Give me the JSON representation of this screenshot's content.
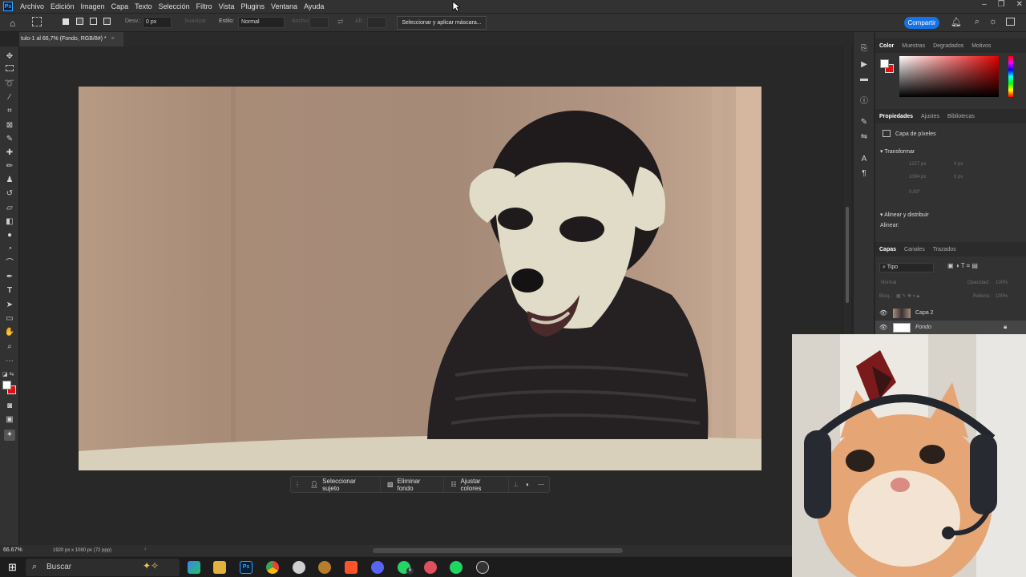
{
  "menu": {
    "logo": "Ps",
    "items": [
      "Archivo",
      "Edición",
      "Imagen",
      "Capa",
      "Texto",
      "Selección",
      "Filtro",
      "Vista",
      "Plugins",
      "Ventana",
      "Ayuda"
    ]
  },
  "options": {
    "feather_label": "Desv.:",
    "feather_value": "0 px",
    "antialias_label": "Suavizar",
    "style_label": "Estilo:",
    "style_value": "Normal",
    "width_label": "Anchu:",
    "height_label": "Alt.:",
    "mask_button": "Seleccionar y aplicar máscara...",
    "share_button": "Compartir"
  },
  "document": {
    "tab_title": "tulo-1 al 66,7% (Fondo, RGB/8#) *",
    "zoom": "66.67%",
    "size_info": "1920 px x 1080 px (72 ppp)"
  },
  "contextual_bar": {
    "select_subject": "Seleccionar sujeto",
    "remove_background": "Eliminar fondo",
    "adjust_colors": "Ajustar colores"
  },
  "color_panel": {
    "tabs": [
      "Color",
      "Muestras",
      "Degradados",
      "Motivos"
    ],
    "foreground": "#ffffff",
    "background": "#e01010"
  },
  "properties_panel": {
    "tabs": [
      "Propiedades",
      "Ajustes",
      "Bibliotecas"
    ],
    "layer_type": "Capa de píxeles",
    "transform_title": "Transformar",
    "fields": [
      "1227 px",
      "0 px",
      "1094 px",
      "0 px",
      "0,00°"
    ],
    "align_title": "Alinear y distribuir",
    "align_label": "Alinear:"
  },
  "layers_panel": {
    "tabs": [
      "Capas",
      "Canales",
      "Trazados"
    ],
    "filter_label": "Tipo",
    "blend_mode": "Normal",
    "opacity_label": "Opacidad:",
    "opacity_value": "100%",
    "lock_label": "Bloq.:",
    "fill_label": "Relleno:",
    "fill_value": "100%",
    "layers": [
      {
        "name": "Capa 2"
      },
      {
        "name": "Fondo"
      }
    ]
  },
  "taskbar": {
    "search_placeholder": "Buscar",
    "badge": "6"
  }
}
